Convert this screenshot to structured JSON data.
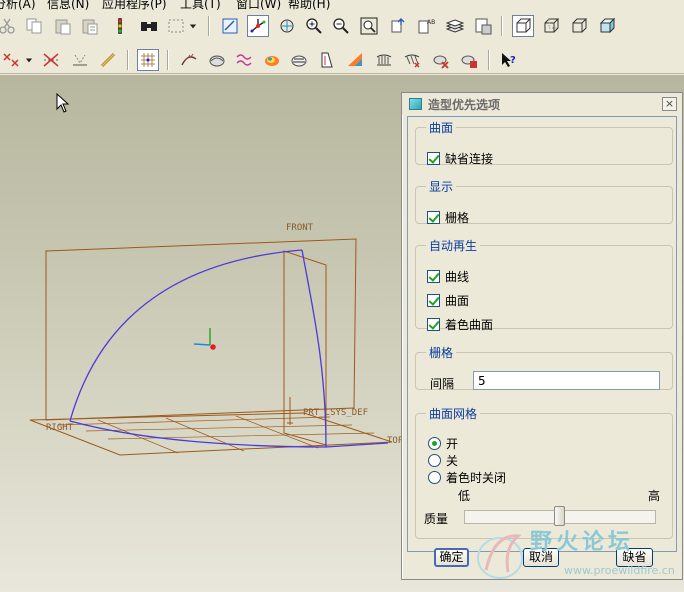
{
  "menubar": {
    "items": [
      "分析(A)",
      "信息(N)",
      "应用程序(P)",
      "工具(T)",
      "窗口(W)",
      "帮助(H)"
    ]
  },
  "toolbar": {
    "row1_icons": [
      "scissors-icon",
      "copy-icon",
      "paste-icon",
      "paste-special-icon",
      "regenerate-icon",
      "find-icon",
      "select-box-icon",
      "dropdown-arrow-icon",
      "repaint-icon",
      "spin-center-icon",
      "orient-mode-icon",
      "zoom-in-icon",
      "zoom-out-icon",
      "refit-icon",
      "reorient-icon",
      "named-views-icon",
      "layers-icon",
      "model-display-icon",
      "wireframe-icon",
      "hidden-line-icon",
      "no-hidden-icon",
      "shading-icon"
    ],
    "row2_icons": [
      "curve-tools-icon",
      "dropdown-arrow-icon",
      "trim-icon",
      "measure-icon",
      "chain-icon",
      "grid-toggle-icon",
      "curve-analysis-icon",
      "surface-analysis-icon",
      "reflection-icon",
      "gaussian-icon",
      "section-icon",
      "offset-icon",
      "draft-icon",
      "deviation-icon",
      "slope-icon",
      "delete-analysis-icon",
      "hide-analysis-icon",
      "hide-all-analysis-icon",
      "whats-this-icon"
    ]
  },
  "scene": {
    "labels": {
      "front": "FRONT",
      "right": "RIGHT",
      "top": "TOP",
      "csys": "PRT_CSYS_DEF"
    },
    "colors": {
      "datum": "#9c5a1c",
      "curve": "#4b3ad9",
      "axis_x": "#e02020",
      "axis_y": "#18a818",
      "axis_z": "#1a8ad8"
    }
  },
  "dialog": {
    "title": "造型优先选项",
    "close": "×",
    "curves_group": {
      "legend": "曲面",
      "default_connect": {
        "label": "缺省连接",
        "checked": true
      }
    },
    "display_group": {
      "legend": "显示",
      "grid": {
        "label": "栅格",
        "checked": true
      }
    },
    "regen_group": {
      "legend": "自动再生",
      "curves": {
        "label": "曲线",
        "checked": true
      },
      "surfaces": {
        "label": "曲面",
        "checked": true
      },
      "shaded_surfaces": {
        "label": "着色曲面",
        "checked": true
      }
    },
    "grid_group": {
      "legend": "栅格",
      "spacing_label": "间隔",
      "spacing_value": "5"
    },
    "mesh_group": {
      "legend": "曲面网格",
      "options": [
        {
          "label": "开",
          "selected": true
        },
        {
          "label": "关",
          "selected": false
        },
        {
          "label": "着色时关闭",
          "selected": false
        }
      ],
      "quality_label": "质量",
      "quality_low": "低",
      "quality_high": "高",
      "quality_level": 0.5
    },
    "buttons": {
      "ok": "确定",
      "cancel": "取消",
      "default": "缺省"
    }
  },
  "watermark": {
    "name": "野火论坛",
    "url": "www.proewildfire.cn"
  }
}
